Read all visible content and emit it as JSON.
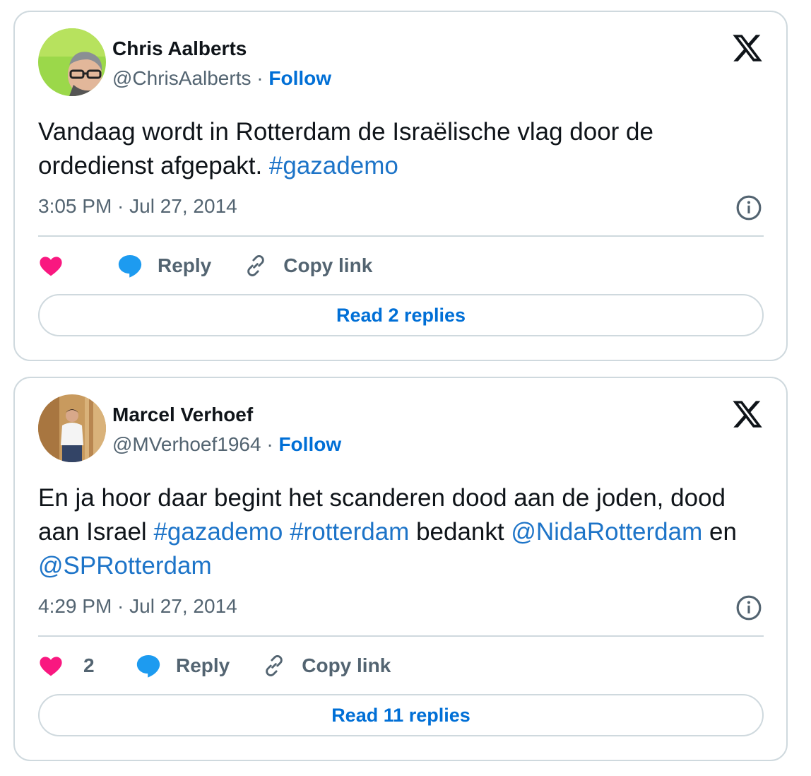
{
  "tweets": [
    {
      "author_name": "Chris Aalberts",
      "handle": "@ChrisAalberts",
      "separator": " · ",
      "follow_label": "Follow",
      "text_parts": [
        {
          "text": "Vandaag wordt in Rotterdam de Israëlische vlag door de ordedienst afgepakt. ",
          "link": false
        },
        {
          "text": "#gazademo",
          "link": true
        }
      ],
      "timestamp": "3:05 PM · Jul 27, 2014",
      "like_count": "",
      "reply_label": "Reply",
      "copy_link_label": "Copy link",
      "read_replies_label": "Read 2 replies"
    },
    {
      "author_name": "Marcel Verhoef",
      "handle": "@MVerhoef1964",
      "separator": " · ",
      "follow_label": "Follow",
      "text_parts": [
        {
          "text": "En ja hoor daar begint het scanderen dood aan de joden, dood aan Israel ",
          "link": false
        },
        {
          "text": "#gazademo",
          "link": true
        },
        {
          "text": " ",
          "link": false
        },
        {
          "text": "#rotterdam",
          "link": true
        },
        {
          "text": " bedankt ",
          "link": false
        },
        {
          "text": "@NidaRotterdam",
          "link": true
        },
        {
          "text": " en ",
          "link": false
        },
        {
          "text": "@SPRotterdam",
          "link": true
        }
      ],
      "timestamp": "4:29 PM · Jul 27, 2014",
      "like_count": "2",
      "reply_label": "Reply",
      "copy_link_label": "Copy link",
      "read_replies_label": "Read 11 replies"
    }
  ],
  "icons": {
    "logo": "x-logo-icon",
    "info": "info-icon",
    "like": "heart-icon",
    "reply": "speech-bubble-icon",
    "copy": "link-icon"
  },
  "colors": {
    "link": "#1d74c8",
    "follow": "#006fd6",
    "heart": "#f91880",
    "reply_bubble": "#1d9bf0",
    "secondary_text": "#536471",
    "border": "#cfd9de"
  }
}
